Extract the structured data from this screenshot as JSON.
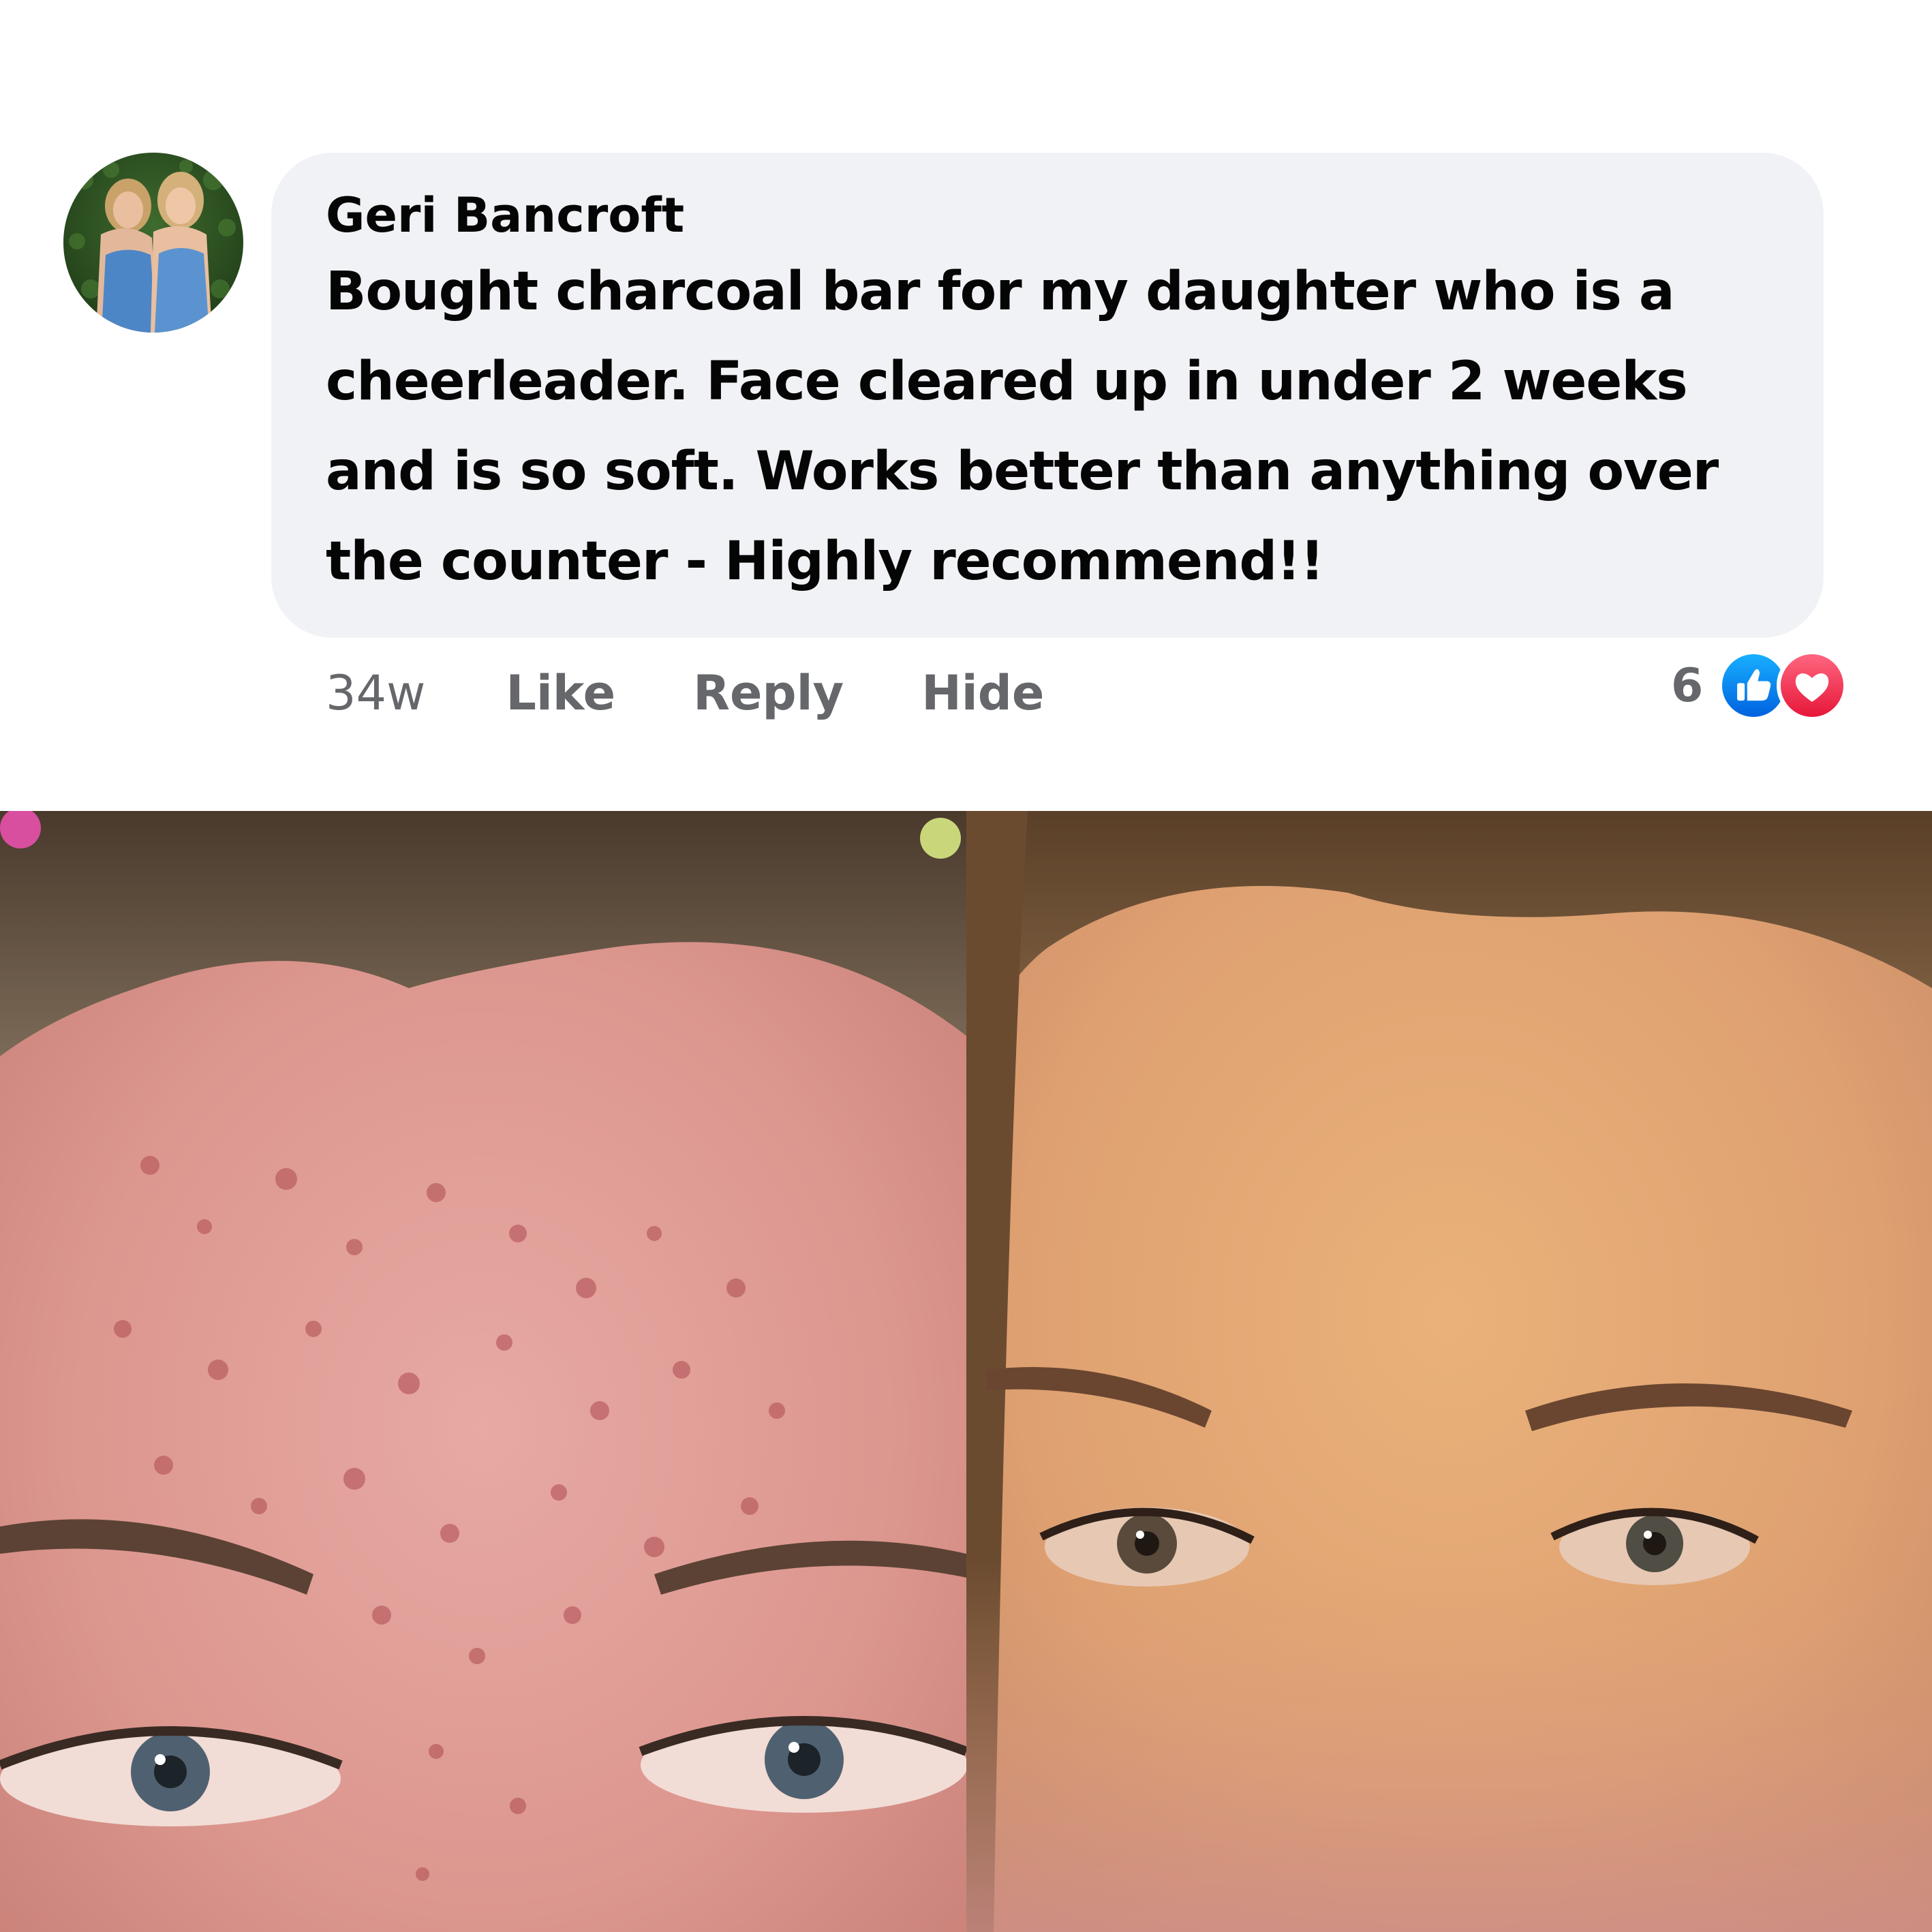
{
  "comment": {
    "author": "Geri Bancroft",
    "text_lines": [
      "Bought charcoal bar for my daughter who is a",
      "cheerleader. Face cleared up in under 2 weeks",
      "and is so soft. Works better than anything over",
      "the counter - Highly recommend!!"
    ],
    "timestamp": "34w",
    "actions": {
      "like": "Like",
      "reply": "Reply",
      "hide": "Hide"
    },
    "reactions": {
      "count": "6",
      "types": [
        "like-icon",
        "love-icon"
      ]
    }
  },
  "colors": {
    "bubble_bg": "#f0f2f5",
    "text": "#050505",
    "secondary_text": "#65676b",
    "like_blue": "#1877f2",
    "love_red": "#f33e58"
  },
  "photos": {
    "before": "acne-before-photo",
    "after": "clear-skin-after-photo"
  }
}
